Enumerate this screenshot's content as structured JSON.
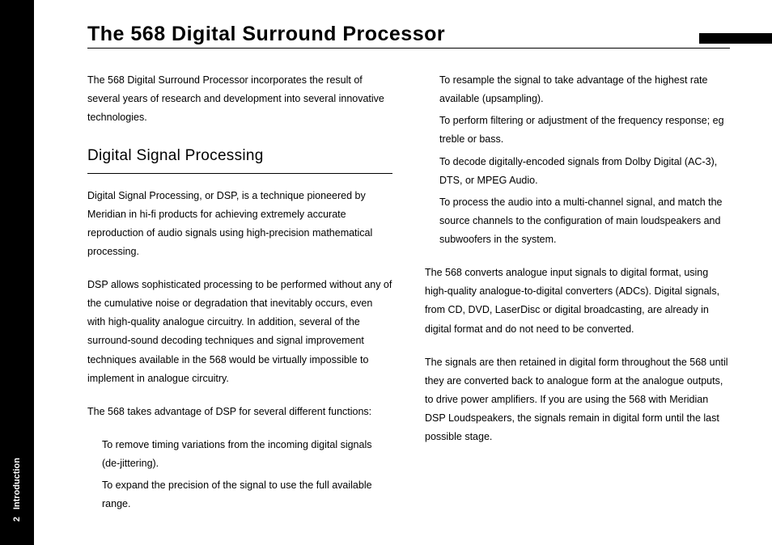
{
  "sidebar": {
    "page_number": "2",
    "section": "Introduction"
  },
  "header": {
    "title": "The 568 Digital Surround Processor"
  },
  "left": {
    "intro": "The 568 Digital Surround Processor incorporates the result of several years of research and development into several innovative technologies.",
    "subheading": "Digital Signal Processing",
    "p1": "Digital Signal Processing, or DSP, is a technique pioneered by Meridian in hi-fi products for achieving extremely accurate reproduction of audio signals using high-precision mathematical processing.",
    "p2": "DSP allows sophisticated processing to be performed without any of the cumulative noise or degradation that inevitably occurs, even with high-quality analogue circuitry. In addition, several of the surround-sound decoding techniques and signal improvement techniques available in the 568 would be virtually impossible to implement in analogue circuitry.",
    "p3": "The 568 takes advantage of DSP for several different functions:",
    "b1": "To remove timing variations from the incoming digital signals (de-jittering).",
    "b2": "To expand the precision of the signal to use the full available range."
  },
  "right": {
    "b3": "To resample the signal to take advantage of the highest rate available (upsampling).",
    "b4": "To perform filtering or adjustment of the frequency response; eg treble or bass.",
    "b5": "To decode digitally-encoded signals from Dolby Digital (AC-3), DTS, or MPEG Audio.",
    "b6": "To process the audio into a multi-channel signal, and match the source channels to the configuration of main loudspeakers and subwoofers in the system.",
    "p4": "The 568 converts analogue input signals to digital format, using high-quality analogue-to-digital converters (ADCs). Digital signals, from CD, DVD, LaserDisc or digital broadcasting, are already in digital format and do not need to be converted.",
    "p5": "The signals are then retained in digital form throughout the 568 until they are converted back to analogue form at the analogue outputs, to drive power amplifiers. If you are using the 568 with Meridian DSP Loudspeakers, the signals remain in digital form until the last possible stage."
  }
}
